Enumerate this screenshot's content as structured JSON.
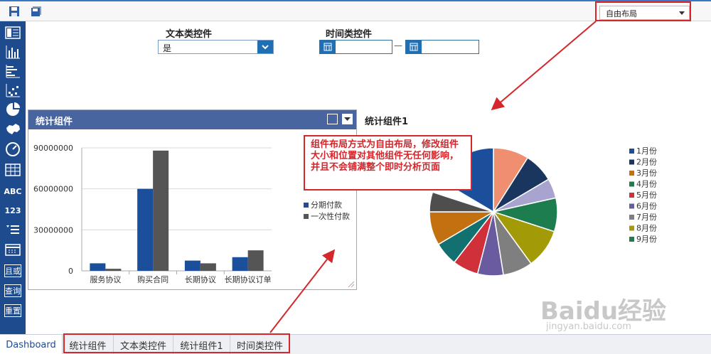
{
  "toolbar": {
    "save_icon": "save-icon",
    "save_all_icon": "save-all-icon",
    "layout_select": "自由布局"
  },
  "sidebar": {
    "items": [
      {
        "icon": "table-layout-icon"
      },
      {
        "icon": "bar-chart-icon"
      },
      {
        "icon": "horizontal-bar-chart-icon"
      },
      {
        "icon": "scatter-chart-icon"
      },
      {
        "icon": "pie-chart-icon"
      },
      {
        "icon": "map-icon"
      },
      {
        "icon": "gauge-icon"
      },
      {
        "icon": "grid-table-icon"
      },
      {
        "label": "ABC"
      },
      {
        "label": "123"
      },
      {
        "icon": "list-icon"
      },
      {
        "icon": "calendar-icon"
      },
      {
        "label": "且或"
      },
      {
        "label": "查询"
      },
      {
        "label": "重置"
      }
    ]
  },
  "filters": {
    "text_label": "文本类控件",
    "text_value": "是",
    "time_label": "时间类控件",
    "date_sep": "—"
  },
  "panel": {
    "title": "统计组件"
  },
  "pie_title": "统计组件1",
  "note": "组件布局方式为自由布局，修改组件大小和位置对其他组件无任何影响，并且不会铺满整个即时分析页面",
  "tabs": [
    "Dashboard",
    "统计组件",
    "文本类控件",
    "统计组件1",
    "时间类控件"
  ],
  "watermark": {
    "main": "Baidu经验",
    "sub": "jingyan.baidu.com"
  },
  "colors": {
    "sidebar": "#1e4a8e",
    "accent": "#1e6fb3",
    "panel_head": "#4865a0",
    "annotation": "#d4262b"
  },
  "chart_data": [
    {
      "type": "bar",
      "categories": [
        "服务协议",
        "购买合同",
        "长期协议",
        "长期协议订单"
      ],
      "series": [
        {
          "name": "分期付款",
          "values": [
            5500000,
            60000000,
            7500000,
            10000000
          ],
          "color": "#1b4f9c"
        },
        {
          "name": "一次性付款",
          "values": [
            1500000,
            88000000,
            5500000,
            15000000
          ],
          "color": "#555555"
        }
      ],
      "yticks": [
        "0",
        "30000000",
        "60000000",
        "90000000"
      ],
      "ylim": [
        0,
        90000000
      ],
      "grid": true,
      "legend": "right"
    },
    {
      "type": "pie",
      "title": "统计组件1",
      "labels": [
        "1月份",
        "2月份",
        "3月份",
        "4月份",
        "5月份",
        "6月份",
        "7月份",
        "8月份",
        "9月份"
      ],
      "slices": [
        {
          "value": 9,
          "color": "#ef8f6f"
        },
        {
          "value": 7.5,
          "color": "#1a365f"
        },
        {
          "value": 5,
          "color": "#a9a3d0"
        },
        {
          "value": 8.5,
          "color": "#1e7d4e"
        },
        {
          "value": 10,
          "color": "#a39a08"
        },
        {
          "value": 7.5,
          "color": "#7f7f7f"
        },
        {
          "value": 6.5,
          "color": "#6a5aa0"
        },
        {
          "value": 6.5,
          "color": "#d0303a"
        },
        {
          "value": 6,
          "color": "#137070"
        },
        {
          "value": 8.5,
          "color": "#c27010"
        },
        {
          "value": 5,
          "color": "#4e4e4e"
        },
        {
          "value": 3.5,
          "color": "#ffffff"
        },
        {
          "value": 16.5,
          "color": "#1b4f9c"
        }
      ],
      "legend_colors": [
        "#1b4f9c",
        "#1a365f",
        "#c27010",
        "#1e7d4e",
        "#d0303a",
        "#6a5aa0",
        "#7f7f7f",
        "#a39a08",
        "#1e7d4e"
      ],
      "legend": "right"
    }
  ]
}
